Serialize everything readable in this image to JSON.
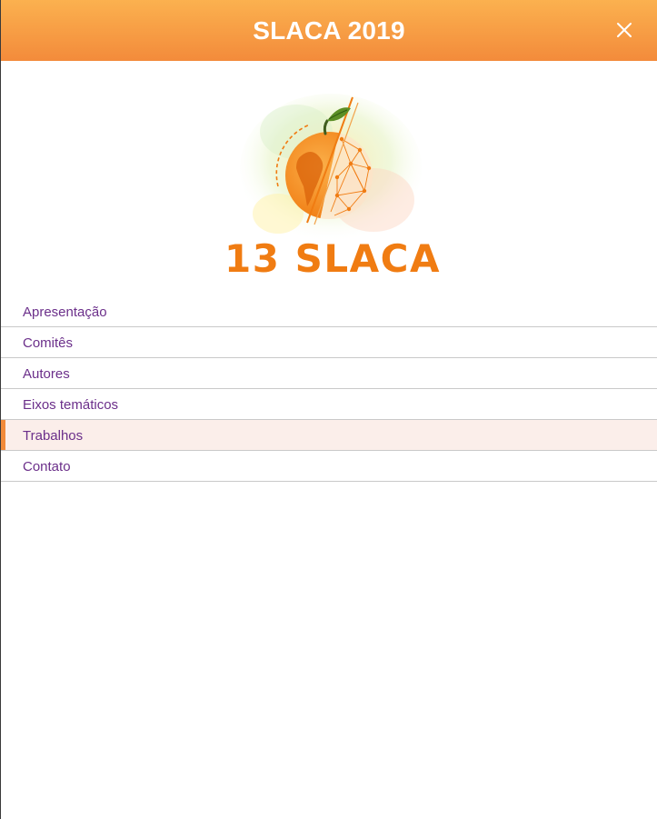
{
  "header": {
    "title": "SLACA 2019"
  },
  "logo": {
    "text": "13 SLACA"
  },
  "nav": {
    "items": [
      {
        "label": "Apresentação"
      },
      {
        "label": "Comitês"
      },
      {
        "label": "Autores"
      },
      {
        "label": "Eixos temáticos"
      },
      {
        "label": "Trabalhos",
        "active": true
      },
      {
        "label": "Contato"
      }
    ]
  },
  "colors": {
    "header_top": "#fbb14f",
    "header_bottom": "#f38b3b",
    "menu_text": "#6b2f8a",
    "active_bg": "#fbeeea",
    "active_bar": "#f18a3a",
    "logo_orange": "#f07c12"
  }
}
